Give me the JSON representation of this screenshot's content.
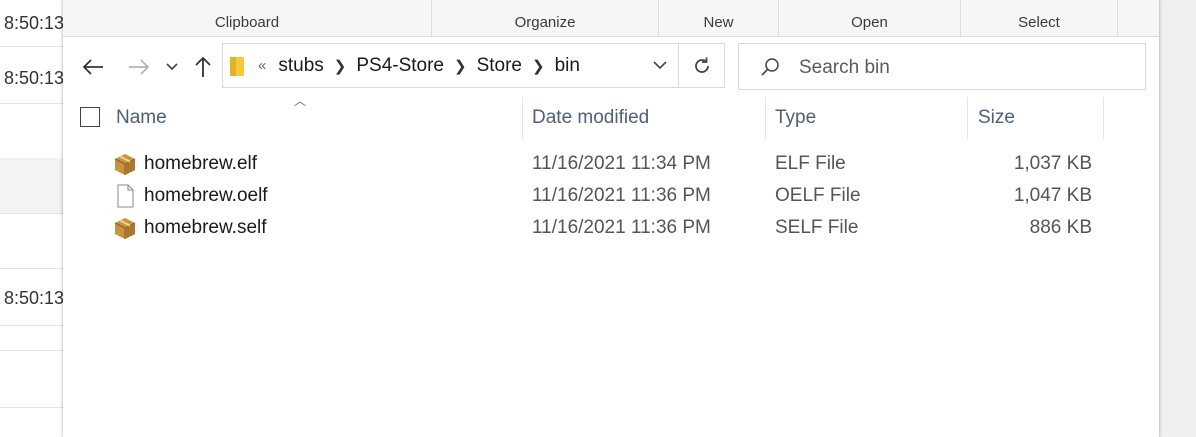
{
  "background_window": {
    "times": [
      "8:50:13",
      "8:50:13",
      "8:50:13"
    ]
  },
  "ribbon": {
    "groups": [
      {
        "id": "clipboard",
        "label": "Clipboard"
      },
      {
        "id": "organize",
        "label": "Organize"
      },
      {
        "id": "new",
        "label": "New"
      },
      {
        "id": "open",
        "label": "Open"
      },
      {
        "id": "select",
        "label": "Select"
      }
    ]
  },
  "address_bar": {
    "overflow": "«",
    "crumbs": [
      "stubs",
      "PS4-Store",
      "Store",
      "bin"
    ]
  },
  "search": {
    "placeholder": "Search bin"
  },
  "columns": {
    "name": "Name",
    "date": "Date modified",
    "type": "Type",
    "size": "Size"
  },
  "files": [
    {
      "name": "homebrew.elf",
      "date": "11/16/2021 11:34 PM",
      "type": "ELF File",
      "size": "1,037 KB",
      "icon": "package-icon"
    },
    {
      "name": "homebrew.oelf",
      "date": "11/16/2021 11:36 PM",
      "type": "OELF File",
      "size": "1,047 KB",
      "icon": "blank-file-icon"
    },
    {
      "name": "homebrew.self",
      "date": "11/16/2021 11:36 PM",
      "type": "SELF File",
      "size": "886 KB",
      "icon": "package-icon"
    }
  ]
}
